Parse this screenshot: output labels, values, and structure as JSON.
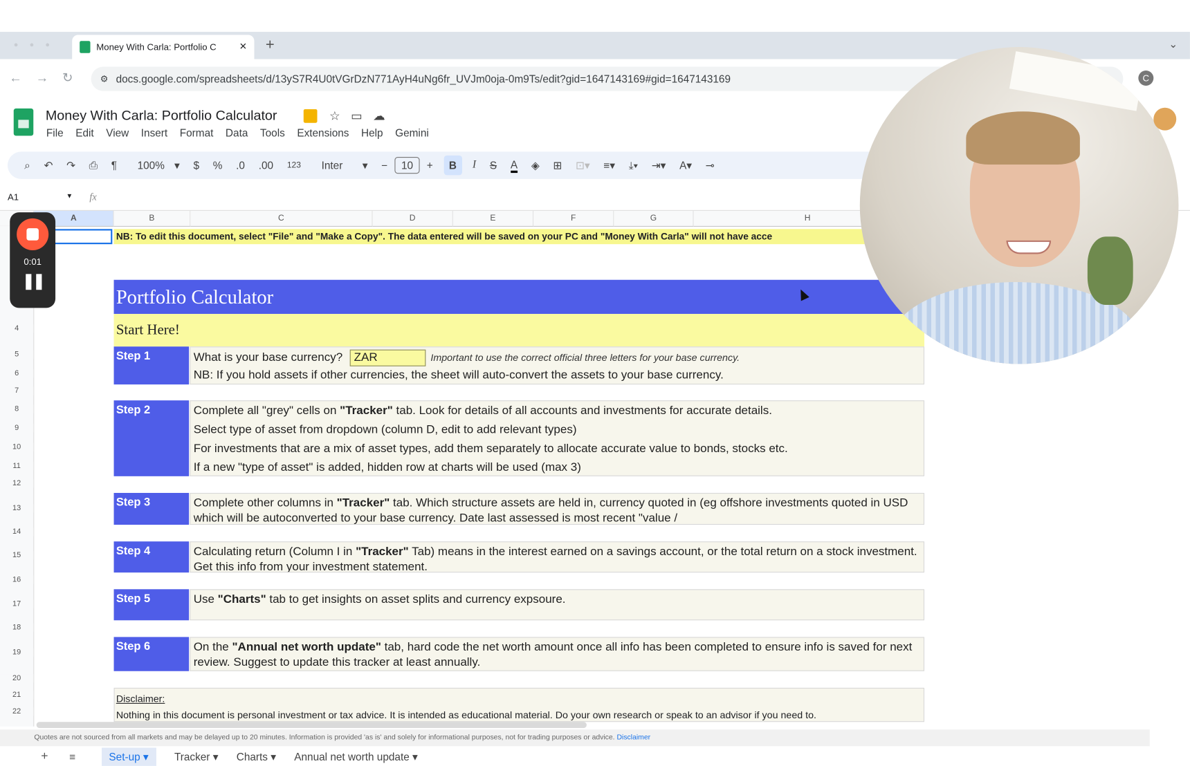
{
  "browser": {
    "tab_title": "Money With Carla: Portfolio C",
    "new_tab": "+",
    "close": "×",
    "url": "docs.google.com/spreadsheets/d/13yS7R4U0tVGrDzN771AyH4uNg6fr_UVJm0oja-0m9Ts/edit?gid=1647143169#gid=1647143169",
    "profile_initial": "C"
  },
  "doc": {
    "title": "Money With Carla: Portfolio Calculator",
    "menu": [
      "File",
      "Edit",
      "View",
      "Insert",
      "Format",
      "Data",
      "Tools",
      "Extensions",
      "Help",
      "Gemini"
    ]
  },
  "toolbar": {
    "zoom": "100%",
    "currency": "$",
    "percent": "%",
    "dec_less": ".0",
    "dec_more": ".00",
    "format_num": "123",
    "font": "Inter",
    "font_size": "10",
    "minus": "−",
    "plus": "+",
    "bold": "B",
    "italic": "I",
    "strike": "S",
    "text_color": "A"
  },
  "formula_bar": {
    "cell_ref": "A1",
    "fx": "fx"
  },
  "columns": [
    "A",
    "B",
    "C",
    "D",
    "E",
    "F",
    "G",
    "H"
  ],
  "rows": [
    "4",
    "5",
    "6",
    "7",
    "8",
    "9",
    "10",
    "11",
    "12",
    "13",
    "14",
    "15",
    "16",
    "17",
    "18",
    "19",
    "20",
    "21",
    "22"
  ],
  "recorder": {
    "time": "0:01"
  },
  "sheet": {
    "banner": "NB: To edit this document, select \"File\" and \"Make a Copy\". The data entered will be saved on your PC and \"Money With Carla\" will not have acce",
    "header": "Portfolio Calculator",
    "start": "Start Here!",
    "step1": {
      "label": "Step 1",
      "question": "What is your base currency?",
      "currency_value": "ZAR",
      "note": "Important to use the correct official three letters for your base currency.",
      "line2": "NB: If you hold assets if other currencies, the sheet will auto-convert the assets to your base currency."
    },
    "step2": {
      "label": "Step 2",
      "l1a": "Complete all \"grey\" cells on ",
      "l1b": "\"Tracker\"",
      "l1c": " tab. Look for details of all accounts and investments for accurate details.",
      "l2": "Select type of asset from dropdown (column D, edit to add relevant types)",
      "l3": "For investments that are a mix of asset types, add them separately to allocate accurate value to bonds, stocks etc.",
      "l4": "If a new \"type of asset\" is added, hidden row at charts will be used (max 3)"
    },
    "step3": {
      "label": "Step 3",
      "a": "Complete other columns in ",
      "b": "\"Tracker\"",
      "c": " tab. Which structure assets are held in, currency quoted in (eg offshore investments quoted in USD which will be autoconverted to your base currency. Date last assessed is most recent \"value /"
    },
    "step4": {
      "label": "Step 4",
      "a": "Calculating return (Column I in ",
      "b": "\"Tracker\"",
      "c": " Tab) means in the interest earned on a savings account, or the total return on a stock investment. Get this info from your investment statement."
    },
    "step5": {
      "label": "Step 5",
      "a": "Use ",
      "b": "\"Charts\"",
      "c": " tab to get insights on asset splits and currency expsoure."
    },
    "step6": {
      "label": "Step 6",
      "a": "On the ",
      "b": "\"Annual net worth update\"",
      "c": " tab, hard code the net worth amount once all info has been completed to ensure info is saved for next review. Suggest to update this tracker at least annually."
    },
    "disclaimer": {
      "title": "Disclaimer:",
      "text": "Nothing in this document is personal investment or tax advice. It is intended as educational material. Do your own research or speak to an advisor if you need to."
    }
  },
  "footer": {
    "quote": "Quotes are not sourced from all markets and may be delayed up to 20 minutes. Information is provided 'as is' and solely for informational purposes, not for trading purposes or advice.",
    "link": "Disclaimer"
  },
  "sheet_tabs": [
    "Set-up",
    "Tracker",
    "Charts",
    "Annual net worth update"
  ],
  "colors": {
    "header_blue": "#4f5de8",
    "yellow": "#fafaa0",
    "step_bg": "#f7f6ec"
  }
}
